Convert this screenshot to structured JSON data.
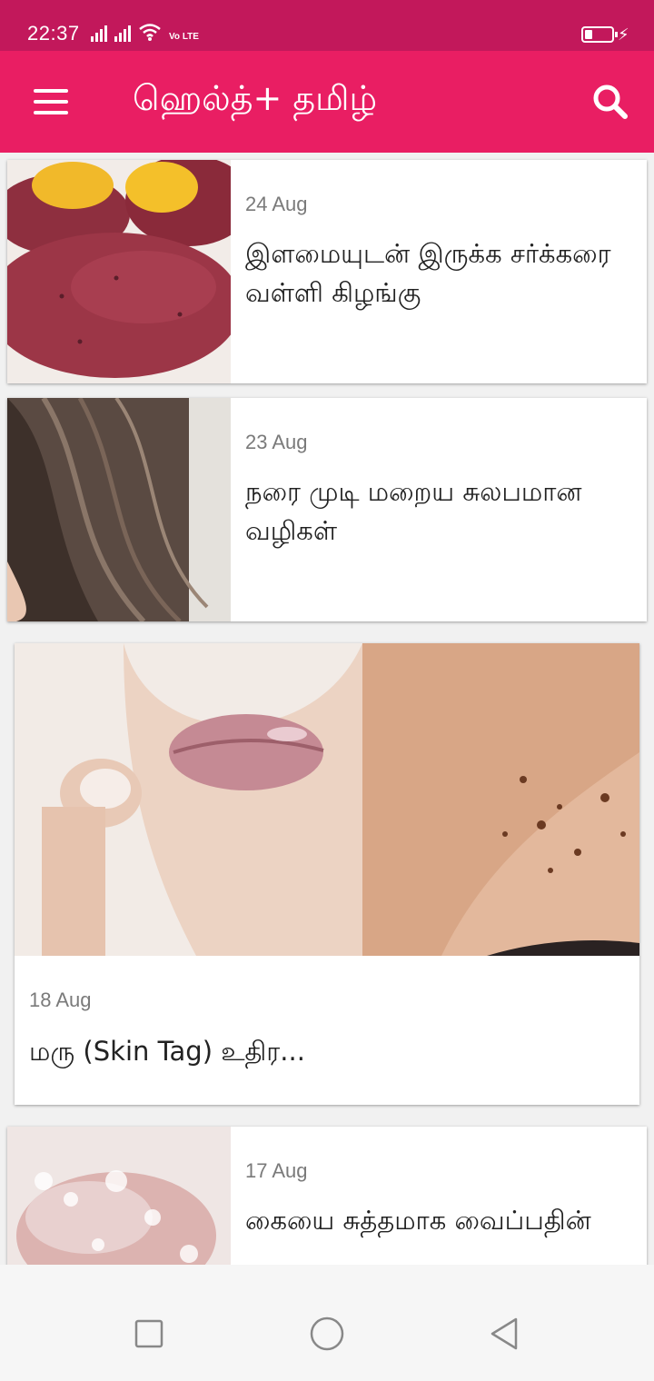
{
  "status_bar": {
    "time": "22:37",
    "network_label": "Vo LTE",
    "icons": [
      "signal-icon",
      "signal-icon",
      "wifi-icon",
      "volte-icon",
      "battery-icon",
      "charging-icon"
    ]
  },
  "app_bar": {
    "title": "ஹெல்த்+ தமிழ்",
    "menu_icon": "hamburger-menu-icon",
    "search_icon": "search-icon",
    "color": "#e91e63",
    "status_color": "#c2185b"
  },
  "articles": [
    {
      "date": "24 Aug",
      "title": "இளமையுடன் இருக்க சர்க்கரை வள்ளி கிழங்கு",
      "image": "sweet-potato-image"
    },
    {
      "date": "23 Aug",
      "title": "நரை முடி மறைய சுலபமான வழிகள்",
      "image": "hair-image"
    },
    {
      "date": "18 Aug",
      "title": "மரு (Skin Tag) உதிர...",
      "image": "skin-tag-image"
    },
    {
      "date": "17 Aug",
      "title": "கையை சுத்தமாக வைப்பதின்",
      "image": "hand-washing-image"
    }
  ],
  "nav_bar": {
    "icons": [
      "recent-apps-icon",
      "home-icon",
      "back-icon"
    ]
  }
}
